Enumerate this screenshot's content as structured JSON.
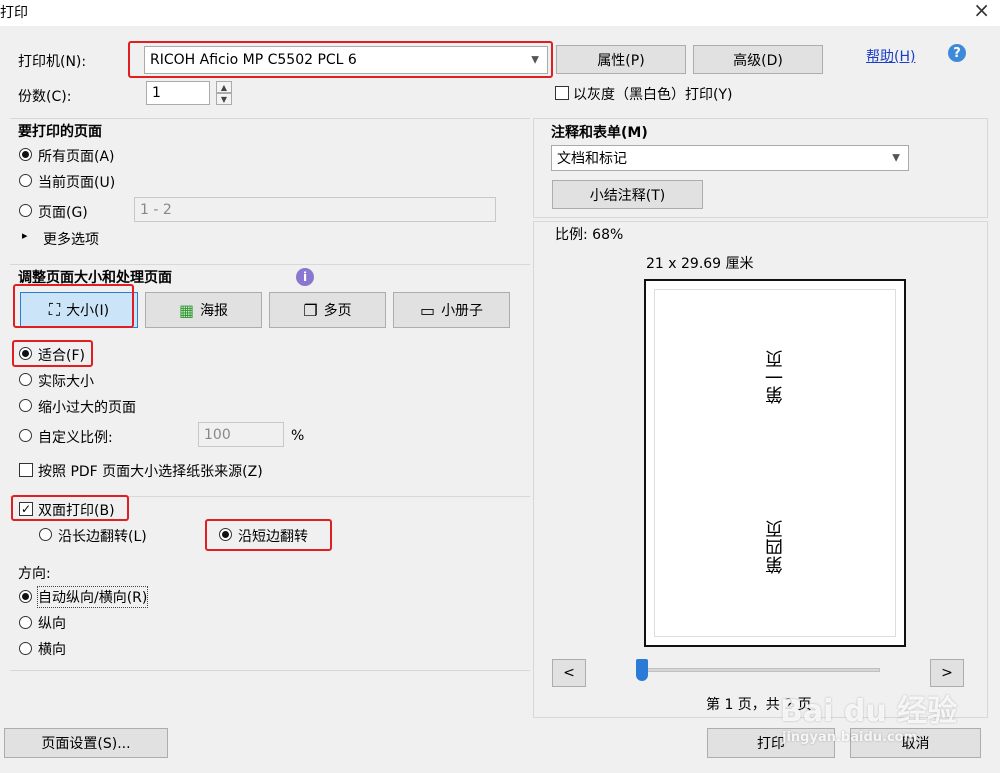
{
  "window": {
    "title": "打印",
    "close_glyph": "×"
  },
  "printer": {
    "label": "打印机(N):",
    "selected": "RICOH Aficio MP C5502 PCL 6",
    "properties_label": "属性(P)",
    "advanced_label": "高级(D)",
    "help_label": "帮助(H)",
    "help_glyph": "?"
  },
  "copies": {
    "label": "份数(C):",
    "value": "1",
    "grayscale_label": "以灰度（黑白色）打印(Y)"
  },
  "pages_to_print": {
    "heading": "要打印的页面",
    "all": "所有页面(A)",
    "current": "当前页面(U)",
    "pages": "页面(G)",
    "range_value": "1 - 2",
    "more": "更多选项",
    "more_glyph": "▸"
  },
  "sizing": {
    "heading": "调整页面大小和处理页面",
    "info_glyph": "i",
    "tabs": [
      {
        "label": "大小(I)",
        "icon": "size-icon"
      },
      {
        "label": "海报",
        "icon": "poster-icon"
      },
      {
        "label": "多页",
        "icon": "multipage-icon"
      },
      {
        "label": "小册子",
        "icon": "booklet-icon"
      }
    ],
    "fit": "适合(F)",
    "actual": "实际大小",
    "shrink": "缩小过大的页面",
    "custom": "自定义比例:",
    "custom_value": "100",
    "percent": "%",
    "paper_source": "按照 PDF 页面大小选择纸张来源(Z)"
  },
  "duplex": {
    "label": "双面打印(B)",
    "long_edge": "沿长边翻转(L)",
    "short_edge": "沿短边翻转"
  },
  "orientation": {
    "heading": "方向:",
    "auto": "自动纵向/横向(R)",
    "portrait": "纵向",
    "landscape": "横向"
  },
  "comments": {
    "heading": "注释和表单(M)",
    "selected": "文档和标记",
    "summarize_label": "小结注释(T)"
  },
  "preview": {
    "scale": "比例:   68%",
    "dimensions": "21 x 29.69 厘米",
    "page_top": "第一页",
    "page_bottom": "第四页",
    "prev": "<",
    "next": ">",
    "page_indicator": "第 1 页，共 2 页",
    "slider_position": 0.0
  },
  "footer": {
    "page_setup_label": "页面设置(S)...",
    "print_label": "打印",
    "cancel_label": "取消"
  },
  "watermark": {
    "brand": "Bai du 经验",
    "site": "jingyan.baidu.com"
  },
  "colors": {
    "highlight_red": "#e02020",
    "link_blue": "#1a3fc4",
    "slider_blue": "#2b7bd6"
  }
}
